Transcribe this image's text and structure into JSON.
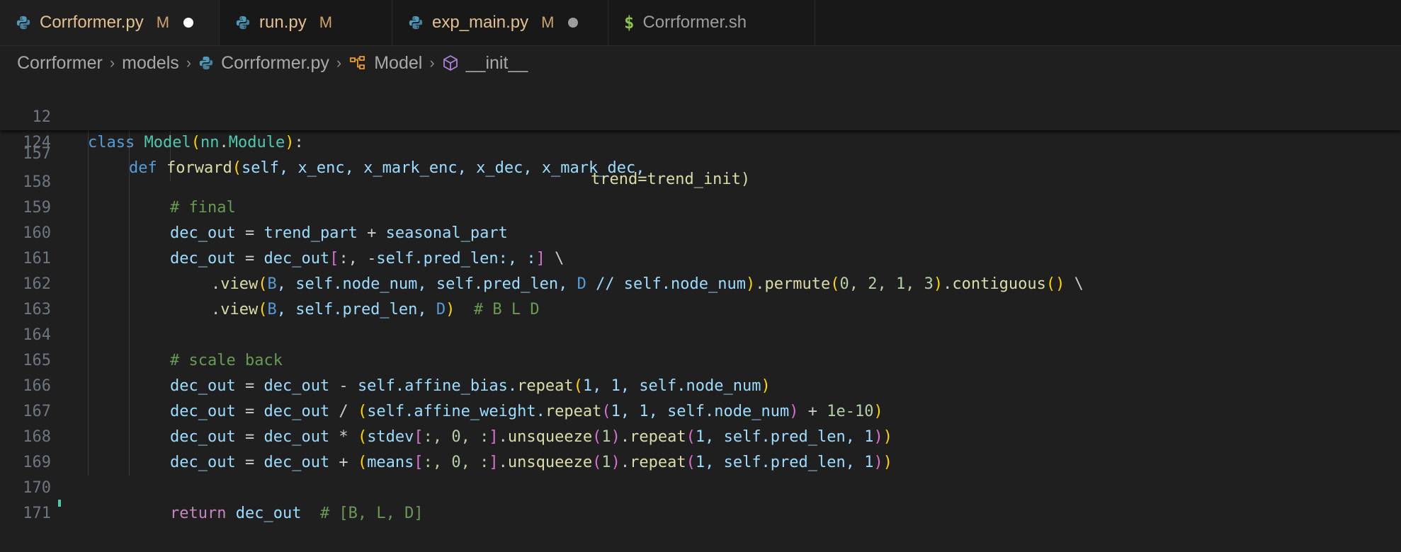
{
  "tabs": [
    {
      "name": "Corrformer.py",
      "status": "M",
      "dirty": true,
      "icon": "python-icon",
      "active": true
    },
    {
      "name": "run.py",
      "status": "M",
      "dirty": false,
      "icon": "python-icon",
      "active": false
    },
    {
      "name": "exp_main.py",
      "status": "M",
      "dirty": true,
      "icon": "python-icon",
      "active": false
    },
    {
      "name": "Corrformer.sh",
      "status": "",
      "dirty": false,
      "icon": "shell-icon",
      "active": false
    }
  ],
  "breadcrumb": {
    "folder": "Corrformer",
    "subfolder": "models",
    "file": "Corrformer.py",
    "class": "Model",
    "method": "__init__",
    "sep": "›"
  },
  "sticky": {
    "l1": {
      "num": "12",
      "kw": "class",
      "name": "Model",
      "p1": "(",
      "mod": "nn",
      "dot": ".",
      "base": "Module",
      "p2": ")",
      "colon": ":"
    },
    "l2": {
      "num": "124",
      "kw": "def",
      "name": "forward",
      "open": "(",
      "args": "self, x_enc, x_mark_enc, x_dec, x_mark_dec,"
    }
  },
  "code": {
    "l157": {
      "num": "157",
      "text": "trend=trend_init)"
    },
    "l158": {
      "num": "158",
      "text": "# final"
    },
    "l159": {
      "num": "159",
      "a": "dec_out",
      "eq": " = ",
      "b": "trend_part",
      "op": " + ",
      "c": "seasonal_part"
    },
    "l160": {
      "num": "160",
      "a": "dec_out",
      "eq": " = ",
      "b": "dec_out",
      "br": "[",
      "s1": ":, -",
      "self": "self",
      "s2": ".pred_len:, :",
      "brc": "]",
      "tail": " \\"
    },
    "l161": {
      "num": "161",
      "dot": ".",
      "fn": "view",
      "p": "(",
      "B": "B",
      "mid": ", self.node_num, self.pred_len, ",
      "D": "D",
      "mid2": " // self.node_num",
      "pc": ")",
      "dot2": ".",
      "fn2": "permute",
      "p2": "(",
      "nums": "0, 2, 1, 3",
      "pc2": ")",
      "dot3": ".",
      "fn3": "contiguous",
      "p3": "()",
      "tail": " \\"
    },
    "l162": {
      "num": "162",
      "dot": ".",
      "fn": "view",
      "p": "(",
      "B": "B",
      "mid": ", self.pred_len, ",
      "D": "D",
      "pc": ")",
      "cm": "  # B L D"
    },
    "l163": {
      "num": "163"
    },
    "l164": {
      "num": "164",
      "text": "# scale back"
    },
    "l165": {
      "num": "165",
      "a": "dec_out",
      "eq": " = ",
      "b": "dec_out",
      "op": " - ",
      "c": "self.affine_bias.",
      "fn": "repeat",
      "p": "(",
      "args": "1, 1, self.node_num",
      "pc": ")"
    },
    "l166": {
      "num": "166",
      "a": "dec_out",
      "eq": " = ",
      "b": "dec_out",
      "op": " / ",
      "p0": "(",
      "c": "self.affine_weight.",
      "fn": "repeat",
      "p": "(",
      "args": "1, 1, self.node_num",
      "pc": ")",
      "op2": " + ",
      "n": "1e-10",
      "pc0": ")"
    },
    "l167": {
      "num": "167",
      "a": "dec_out",
      "eq": " = ",
      "b": "dec_out",
      "op": " * ",
      "p0": "(",
      "c": "stdev",
      "br": "[",
      "idx": ":, 0, :",
      "brc": "]",
      "d": ".",
      "fn": "unsqueeze",
      "p": "(",
      "n": "1",
      "pc": ")",
      "d2": ".",
      "fn2": "repeat",
      "p2": "(",
      "args": "1, self.pred_len, 1",
      "pc2": ")",
      "pc0": ")"
    },
    "l168": {
      "num": "168",
      "a": "dec_out",
      "eq": " = ",
      "b": "dec_out",
      "op": " + ",
      "p0": "(",
      "c": "means",
      "br": "[",
      "idx": ":, 0, :",
      "brc": "]",
      "d": ".",
      "fn": "unsqueeze",
      "p": "(",
      "n": "1",
      "pc": ")",
      "d2": ".",
      "fn2": "repeat",
      "p2": "(",
      "args": "1, self.pred_len, 1",
      "pc2": ")",
      "pc0": ")"
    },
    "l169": {
      "num": "169"
    },
    "l170": {
      "num": "170",
      "kw": "return",
      "v": "dec_out",
      "cm": "  # [B, L, D]"
    },
    "l171": {
      "num": "171"
    }
  }
}
